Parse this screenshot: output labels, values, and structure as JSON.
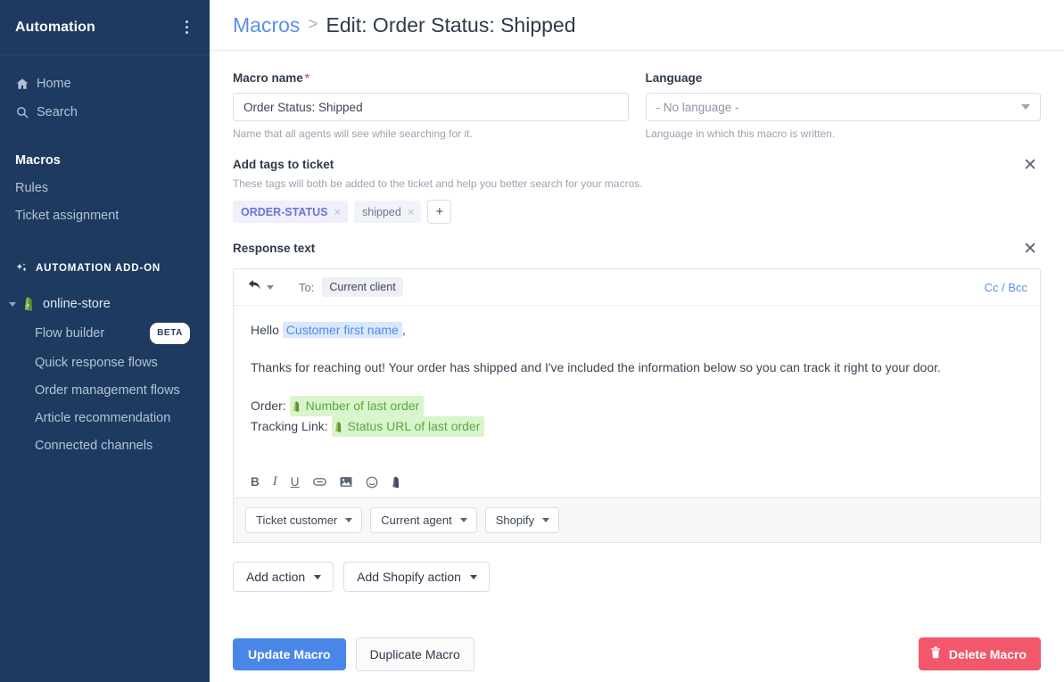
{
  "sidebar": {
    "title": "Automation",
    "menu_icon": "kebab-menu-icon",
    "nav": [
      {
        "label": "Home",
        "icon": "home-icon"
      },
      {
        "label": "Search",
        "icon": "search-icon"
      }
    ],
    "group": [
      {
        "label": "Macros",
        "active": true
      },
      {
        "label": "Rules",
        "active": false
      },
      {
        "label": "Ticket assignment",
        "active": false
      }
    ],
    "section_label": "AUTOMATION ADD-ON",
    "section_icon": "sparkles-icon",
    "store": {
      "label": "online-store",
      "icon": "shopify-bag-icon",
      "caret": "chevron-down-icon"
    },
    "store_items": [
      {
        "label": "Flow builder",
        "badge": "BETA"
      },
      {
        "label": "Quick response flows",
        "badge": ""
      },
      {
        "label": "Order management flows",
        "badge": ""
      },
      {
        "label": "Article recommendation",
        "badge": ""
      },
      {
        "label": "Connected channels",
        "badge": ""
      }
    ]
  },
  "breadcrumb": {
    "parent": "Macros",
    "separator": ">",
    "current": "Edit: Order Status: Shipped"
  },
  "form": {
    "macro_name": {
      "label": "Macro name",
      "required_marker": "*",
      "value": "Order Status: Shipped",
      "placeholder": "Macro name",
      "hint": "Name that all agents will see while searching for it."
    },
    "language": {
      "label": "Language",
      "value": "- No language -",
      "hint": "Language in which this macro is written.",
      "caret": "chevron-down-icon"
    }
  },
  "tags_section": {
    "title": "Add tags to ticket",
    "hint": "These tags will both be added to the ticket and help you better search for your macros.",
    "close_icon": "close-icon",
    "tags": [
      {
        "label": "ORDER-STATUS",
        "remove": "×",
        "style": "accent"
      },
      {
        "label": "shipped",
        "remove": "×",
        "style": "plain"
      }
    ],
    "add_label": "+"
  },
  "response": {
    "title": "Response text",
    "close_icon": "close-icon",
    "reply_icon": "reply-arrow-icon",
    "to_label": "To:",
    "to_value": "Current client",
    "cc_bcc": "Cc / Bcc",
    "body": {
      "greeting_prefix": "Hello",
      "greeting_variable": "Customer first name",
      "greeting_suffix": ",",
      "paragraph": "Thanks for reaching out! Your order has shipped and I've included the information below so you can track it right to your door.",
      "order_label": "Order:",
      "order_variable": "Number of last order",
      "tracking_label": "Tracking Link:",
      "tracking_variable": "Status URL of last order"
    },
    "toolbar": [
      {
        "label": "B",
        "name": "bold-icon"
      },
      {
        "label": "I",
        "name": "italic-icon"
      },
      {
        "label": "U",
        "name": "underline-icon"
      },
      {
        "label": "link",
        "name": "link-icon"
      },
      {
        "label": "image",
        "name": "image-icon"
      },
      {
        "label": "emoji",
        "name": "emoji-icon"
      },
      {
        "label": "shopify",
        "name": "shopify-bag-icon"
      }
    ],
    "variable_buttons": [
      {
        "label": "Ticket customer"
      },
      {
        "label": "Current agent"
      },
      {
        "label": "Shopify"
      }
    ]
  },
  "action_buttons": [
    {
      "label": "Add action"
    },
    {
      "label": "Add Shopify action"
    }
  ],
  "footer": {
    "update_label": "Update Macro",
    "duplicate_label": "Duplicate Macro",
    "delete_label": "Delete Macro",
    "delete_icon": "trash-icon"
  },
  "colors": {
    "sidebar_bg": "#1e3a60",
    "primary": "#4a86e8",
    "danger": "#f2576b",
    "link": "#5b8def",
    "tag_accent": "#6b74d6",
    "var_blue": "#4d8bf0",
    "var_green": "#5aa83e",
    "shopify_green": "#95bf47"
  }
}
